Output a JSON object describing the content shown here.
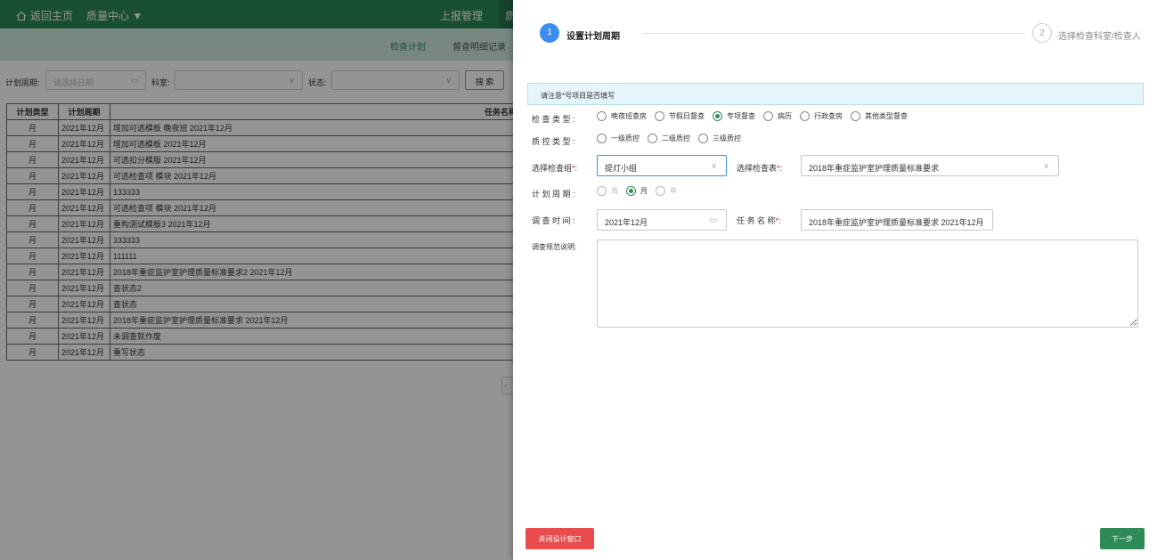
{
  "topnav": {
    "home_label": "返回主页",
    "quality_label": "质量中心 ▼",
    "report_label": "上报管理",
    "active_label": "质"
  },
  "subnav": {
    "tab1": "检查计划",
    "tab2": "督查明细记录"
  },
  "filter": {
    "period_label": "计划周期:",
    "period_placeholder": "请选择日期",
    "dept_label": "科室:",
    "status_label": "状态:",
    "search_label": "搜 索"
  },
  "table": {
    "headers": [
      "计划类型",
      "计划周期",
      "任务名称"
    ],
    "rows": [
      [
        "月",
        "2021年12月",
        "增加可选模板 晚夜班 2021年12月"
      ],
      [
        "月",
        "2021年12月",
        "增加可选模板 2021年12月"
      ],
      [
        "月",
        "2021年12月",
        "可选扣分模版 2021年12月"
      ],
      [
        "月",
        "2021年12月",
        "可选检查项 模块 2021年12月"
      ],
      [
        "月",
        "2021年12月",
        "133333"
      ],
      [
        "月",
        "2021年12月",
        "可选检查项 模块 2021年12月"
      ],
      [
        "月",
        "2021年12月",
        "重构测试模板3 2021年12月"
      ],
      [
        "月",
        "2021年12月",
        "333333"
      ],
      [
        "月",
        "2021年12月",
        "111111"
      ],
      [
        "月",
        "2021年12月",
        "2018年重症监护室护理质量标准要求2 2021年12月"
      ],
      [
        "月",
        "2021年12月",
        "查状态2"
      ],
      [
        "月",
        "2021年12月",
        "查状态"
      ],
      [
        "月",
        "2021年12月",
        "2018年重症监护室护理质量标准要求 2021年12月"
      ],
      [
        "月",
        "2021年12月",
        "未调查就作废"
      ],
      [
        "月",
        "2021年12月",
        "重写状态"
      ]
    ],
    "pager_prev": "‹"
  },
  "drawer": {
    "step1": {
      "num": "1",
      "title": "设置计划周期"
    },
    "step2": {
      "num": "2",
      "title": "选择检查科室/检查人"
    },
    "notice": "请注意*号项目是否填写",
    "check_type": {
      "label": "检 查 类 型 :",
      "options": [
        "晚夜班查房",
        "节假日督查",
        "专项督查",
        "病历",
        "行政查房",
        "其他类型督查"
      ],
      "selected": "专项督查"
    },
    "qc_type": {
      "label": "质 控 类 型 :",
      "options": [
        "一级质控",
        "二级质控",
        "三级质控"
      ]
    },
    "group": {
      "label": "选择检查组",
      "value": "提灯小组"
    },
    "sheet": {
      "label": "选择检查表",
      "value": "2018年重症监护室护理质量标准要求"
    },
    "period": {
      "label": "计 划 周 期 :",
      "options": [
        "周",
        "月",
        "年"
      ],
      "selected": "月"
    },
    "survey_time": {
      "label": "调 查 时 间 :",
      "value": "2021年12月"
    },
    "task_name": {
      "label": "任 务 名 称",
      "value": "2018年重症监护室护理质量标准要求 2021年12月"
    },
    "desc": {
      "label": "调查规范说明:"
    },
    "close_button": "关闭设计窗口",
    "next_button": "下一步"
  },
  "colors": {
    "brand_green": "#2e8b57",
    "step_blue": "#3b8df2",
    "danger_red": "#e84c4c"
  }
}
